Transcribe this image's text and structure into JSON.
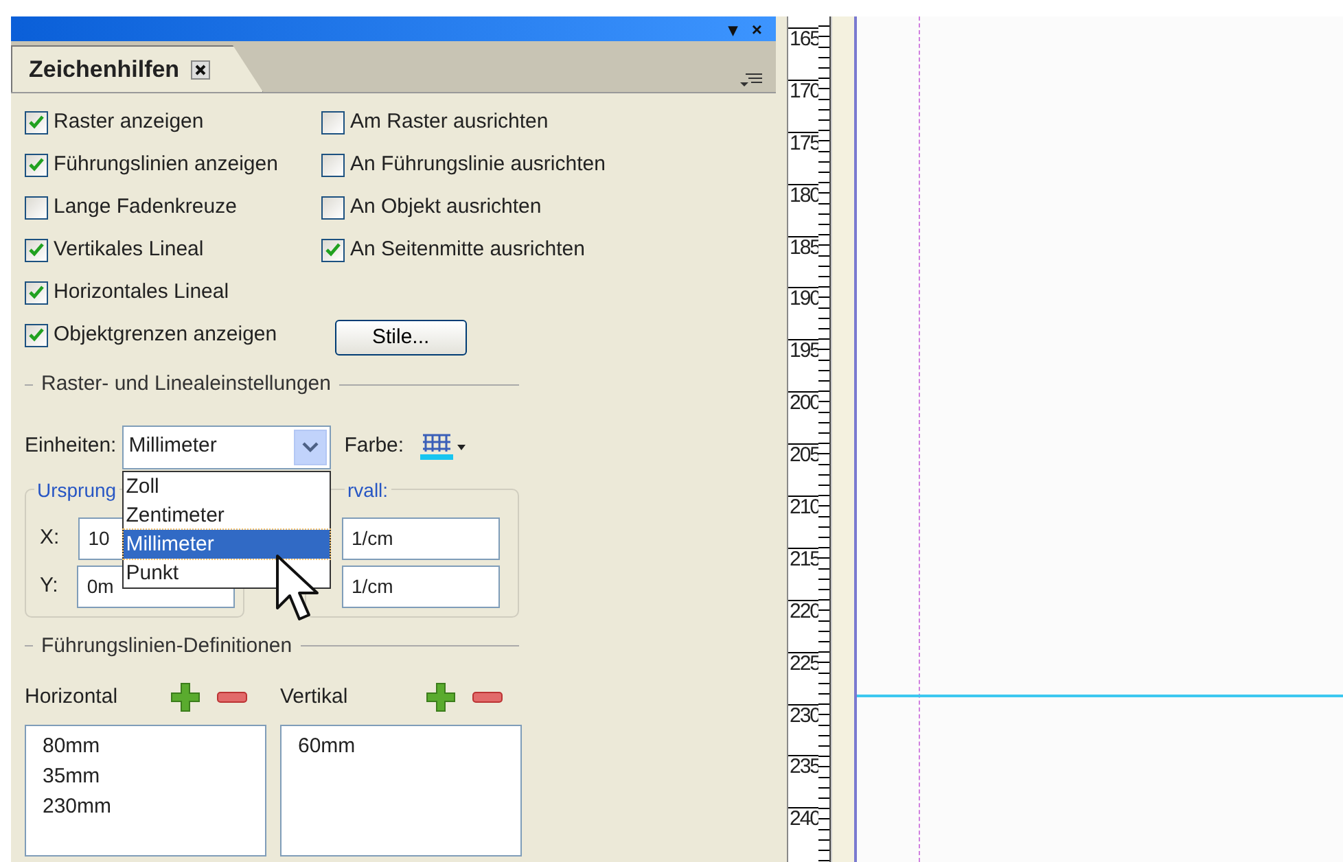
{
  "title_bar": {
    "buttons": [
      "▾",
      "×"
    ]
  },
  "tab": {
    "label": "Zeichenhilfen",
    "selected": true
  },
  "options_left": [
    {
      "label": "Raster anzeigen",
      "checked": true
    },
    {
      "label": "Führungslinien anzeigen",
      "checked": true
    },
    {
      "label": "Lange Fadenkreuze",
      "checked": false
    },
    {
      "label": "Vertikales Lineal",
      "checked": true
    },
    {
      "label": "Horizontales Lineal",
      "checked": true
    },
    {
      "label": "Objektgrenzen anzeigen",
      "checked": true
    }
  ],
  "options_right": [
    {
      "label": "Am Raster ausrichten",
      "checked": false
    },
    {
      "label": "An Führungslinie ausrichten",
      "checked": false
    },
    {
      "label": "An Objekt ausrichten",
      "checked": false
    },
    {
      "label": "An Seitenmitte ausrichten",
      "checked": true
    }
  ],
  "styles_button": "Stile...",
  "grid_section": {
    "title": "Raster- und Linealeinstellungen",
    "units_label": "Einheiten:",
    "units_value": "Millimeter",
    "color_label": "Farbe:",
    "units_dropdown": {
      "open": true,
      "options": [
        {
          "label": "Zoll",
          "selected": false
        },
        {
          "label": "Zentimeter",
          "selected": false
        },
        {
          "label": "Millimeter",
          "selected": true
        },
        {
          "label": "Punkt",
          "selected": false
        }
      ]
    },
    "origin_group": {
      "title": "Ursprung",
      "x_label": "X:",
      "x_value": "10",
      "y_label": "Y:",
      "y_value": "0m"
    },
    "interval_group": {
      "title": "rvall:",
      "x_value": "1/cm",
      "y_value": "1/cm"
    }
  },
  "guides_section": {
    "title": "Führungslinien-Definitionen",
    "horizontal": {
      "label": "Horizontal",
      "items": [
        "80mm",
        "35mm",
        "230mm"
      ]
    },
    "vertical": {
      "label": "Vertikal",
      "items": [
        "60mm"
      ]
    }
  },
  "ruler": {
    "labels": [
      "165",
      "170",
      "175",
      "180",
      "185",
      "190",
      "195",
      "200",
      "205",
      "210",
      "215",
      "220",
      "225",
      "230",
      "235",
      "240"
    ]
  }
}
